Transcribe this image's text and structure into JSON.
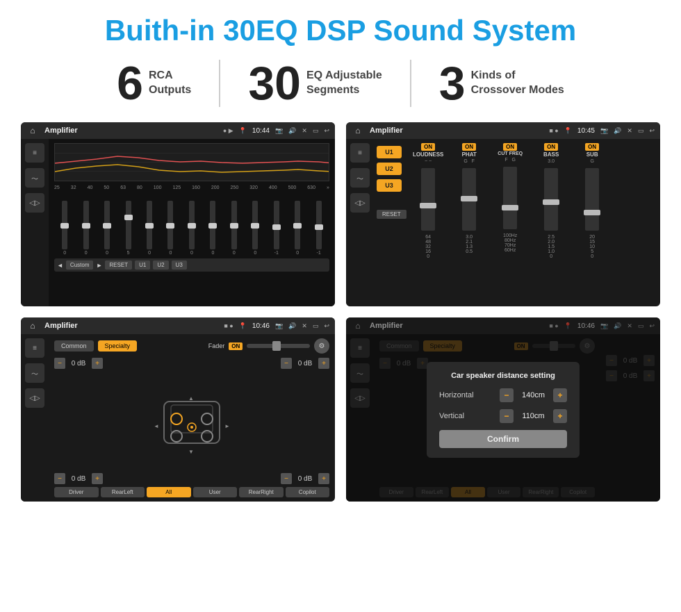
{
  "title": "Buith-in 30EQ DSP Sound System",
  "stats": [
    {
      "number": "6",
      "label": "RCA\nOutputs"
    },
    {
      "number": "30",
      "label": "EQ Adjustable\nSegments"
    },
    {
      "number": "3",
      "label": "Kinds of\nCrossover Modes"
    }
  ],
  "screen1": {
    "title": "Amplifier",
    "time": "10:44",
    "eq_freqs": [
      "25",
      "32",
      "40",
      "50",
      "63",
      "80",
      "100",
      "125",
      "160",
      "200",
      "250",
      "320",
      "400",
      "500",
      "630"
    ],
    "eq_values": [
      "0",
      "0",
      "0",
      "5",
      "0",
      "0",
      "0",
      "0",
      "0",
      "0",
      "0",
      "-1",
      "0",
      "-1"
    ],
    "eq_preset": "Custom",
    "buttons": [
      "RESET",
      "U1",
      "U2",
      "U3"
    ]
  },
  "screen2": {
    "title": "Amplifier",
    "time": "10:45",
    "presets": [
      "U1",
      "U2",
      "U3"
    ],
    "channels": [
      "LOUDNESS",
      "PHAT",
      "CUT FREQ",
      "BASS",
      "SUB"
    ],
    "reset": "RESET"
  },
  "screen3": {
    "title": "Amplifier",
    "time": "10:46",
    "tabs": [
      "Common",
      "Specialty"
    ],
    "fader_label": "Fader",
    "fader_on": "ON",
    "volumes": [
      "0 dB",
      "0 dB",
      "0 dB",
      "0 dB"
    ],
    "bottom_buttons": [
      "Driver",
      "RearLeft",
      "All",
      "User",
      "RearRight",
      "Copilot"
    ]
  },
  "screen4": {
    "title": "Amplifier",
    "time": "10:46",
    "tabs": [
      "Common",
      "Specialty"
    ],
    "dialog": {
      "title": "Car speaker distance setting",
      "horizontal_label": "Horizontal",
      "horizontal_value": "140cm",
      "vertical_label": "Vertical",
      "vertical_value": "110cm",
      "confirm": "Confirm"
    },
    "right_volumes": [
      "0 dB",
      "0 dB"
    ],
    "bottom_buttons": [
      "Driver",
      "RearLeft",
      "All",
      "User",
      "RearRight",
      "Copilot"
    ]
  }
}
